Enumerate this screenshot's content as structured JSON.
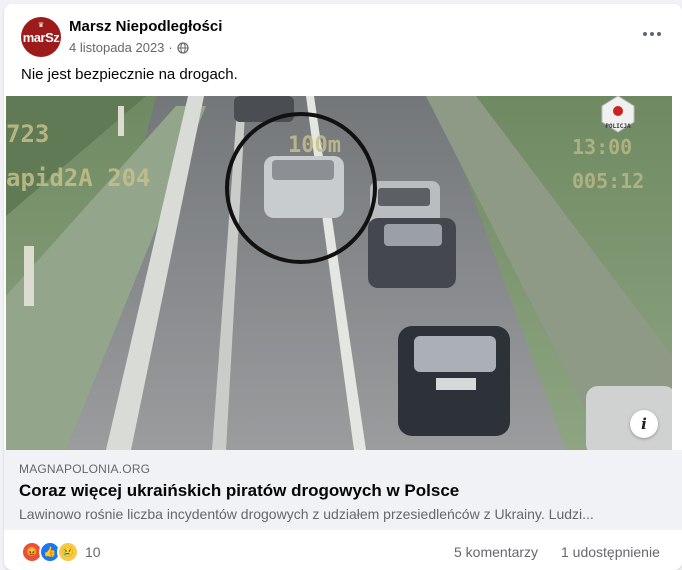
{
  "post": {
    "author": "Marsz Niepodległości",
    "avatar_text": "marSz",
    "date": "4 listopada 2023",
    "separator": "·",
    "text": "Nie jest bezpiecznie na drogach."
  },
  "photo": {
    "overlay_left_top": "723",
    "overlay_left_bottom": "apid2A 204",
    "overlay_distance": "100m",
    "overlay_right_top": "13:00",
    "overlay_right_bottom": "005:12",
    "badge_text": "POLICJA"
  },
  "link": {
    "domain": "MAGNAPOLONIA.ORG",
    "title": "Coraz więcej ukraińskich piratów drogowych w Polsce",
    "description": "Lawinowo rośnie liczba incydentów drogowych z udziałem przesiedleńców z Ukrainy. Ludzi..."
  },
  "stats": {
    "reaction_count": "10",
    "comments": "5 komentarzy",
    "shares": "1 udostępnienie"
  },
  "colors": {
    "brand_red": "#9e1b1b",
    "link_bg": "#f0f2f5",
    "muted_text": "#65676b"
  }
}
